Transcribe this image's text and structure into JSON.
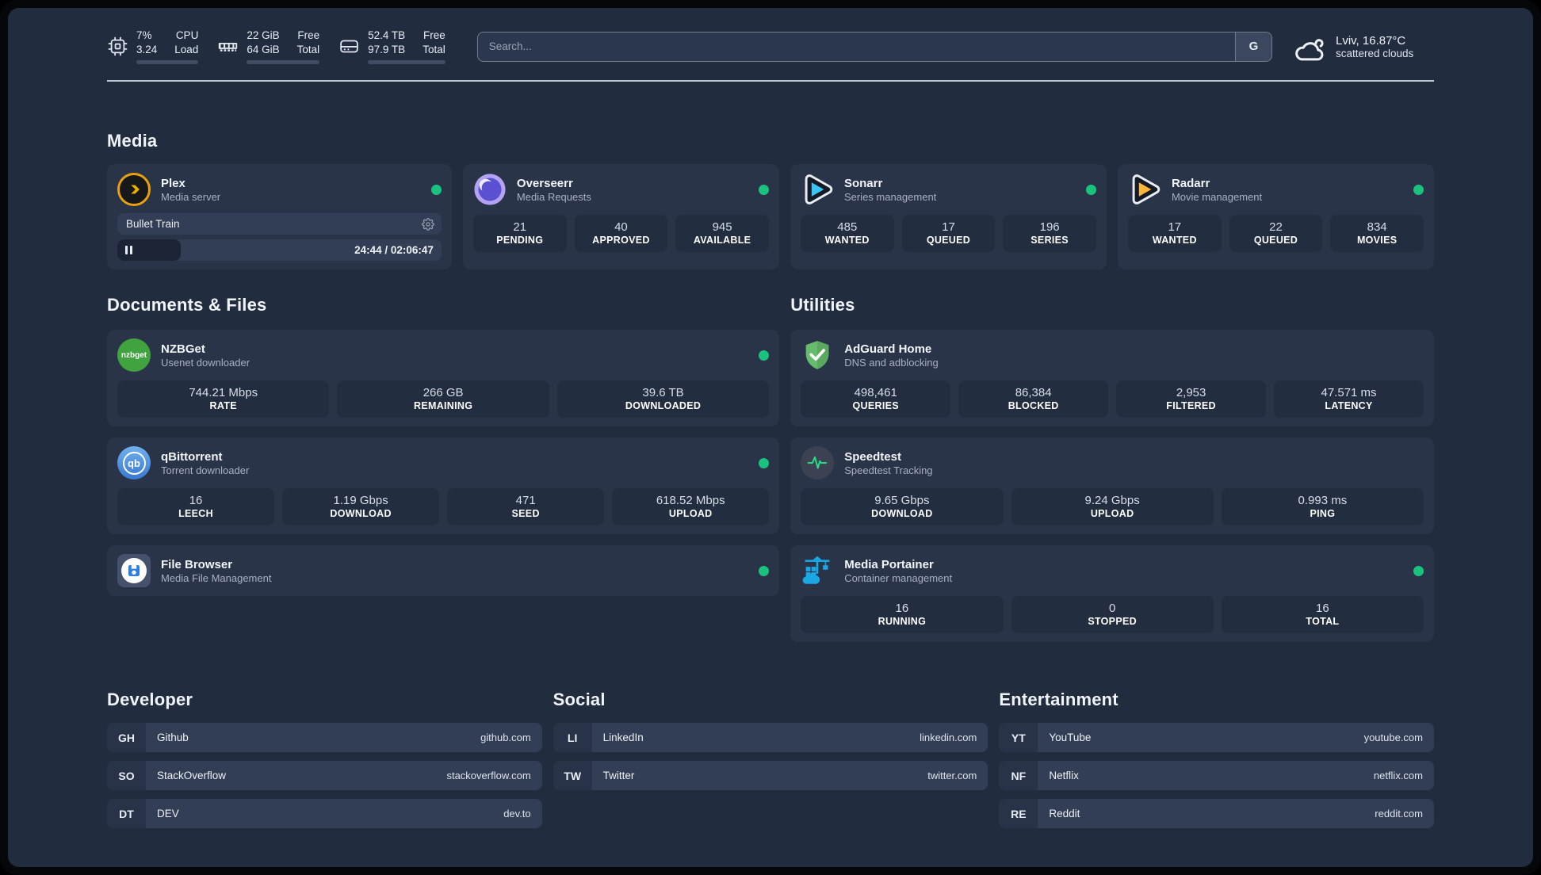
{
  "header": {
    "cpu": {
      "line1": "7%",
      "line2": "3.24",
      "label1": "CPU",
      "label2": "Load",
      "bar_percent": 7
    },
    "ram": {
      "line1": "22 GiB",
      "line2": "64 GiB",
      "label1": "Free",
      "label2": "Total",
      "bar_percent": 66
    },
    "disk": {
      "line1": "52.4 TB",
      "line2": "97.9 TB",
      "label1": "Free",
      "label2": "Total",
      "bar_percent": 46
    },
    "search": {
      "placeholder": "Search...",
      "engine_button": "G"
    },
    "weather": {
      "location_temp": "Lviv, 16.87°C",
      "condition": "scattered clouds"
    }
  },
  "sections": {
    "media": {
      "title": "Media",
      "apps": [
        {
          "name": "Plex",
          "subtitle": "Media server",
          "icon": "plex",
          "status_dot": true,
          "player": {
            "track": "Bullet Train",
            "time": "24:44 / 02:06:47",
            "progress_percent": 19.5
          }
        },
        {
          "name": "Overseerr",
          "subtitle": "Media Requests",
          "icon": "overseerr",
          "status_dot": true,
          "stats": [
            {
              "value": "21",
              "label": "PENDING"
            },
            {
              "value": "40",
              "label": "APPROVED"
            },
            {
              "value": "945",
              "label": "AVAILABLE"
            }
          ]
        },
        {
          "name": "Sonarr",
          "subtitle": "Series management",
          "icon": "sonarr",
          "status_dot": true,
          "stats": [
            {
              "value": "485",
              "label": "WANTED"
            },
            {
              "value": "17",
              "label": "QUEUED"
            },
            {
              "value": "196",
              "label": "SERIES"
            }
          ]
        },
        {
          "name": "Radarr",
          "subtitle": "Movie management",
          "icon": "radarr",
          "status_dot": true,
          "stats": [
            {
              "value": "17",
              "label": "WANTED"
            },
            {
              "value": "22",
              "label": "QUEUED"
            },
            {
              "value": "834",
              "label": "MOVIES"
            }
          ]
        }
      ]
    },
    "documents": {
      "title": "Documents & Files",
      "apps": [
        {
          "name": "NZBGet",
          "subtitle": "Usenet downloader",
          "icon": "nzbget",
          "status_dot": true,
          "stats": [
            {
              "value": "744.21 Mbps",
              "label": "RATE"
            },
            {
              "value": "266 GB",
              "label": "REMAINING"
            },
            {
              "value": "39.6 TB",
              "label": "DOWNLOADED"
            }
          ]
        },
        {
          "name": "qBittorrent",
          "subtitle": "Torrent downloader",
          "icon": "qbittorrent",
          "status_dot": true,
          "stats": [
            {
              "value": "16",
              "label": "LEECH"
            },
            {
              "value": "1.19 Gbps",
              "label": "DOWNLOAD"
            },
            {
              "value": "471",
              "label": "SEED"
            },
            {
              "value": "618.52 Mbps",
              "label": "UPLOAD"
            }
          ]
        },
        {
          "name": "File Browser",
          "subtitle": "Media File Management",
          "icon": "filebrowser",
          "status_dot": true,
          "stats": []
        }
      ]
    },
    "utilities": {
      "title": "Utilities",
      "apps": [
        {
          "name": "AdGuard Home",
          "subtitle": "DNS and adblocking",
          "icon": "adguard",
          "status_dot": false,
          "stats": [
            {
              "value": "498,461",
              "label": "QUERIES"
            },
            {
              "value": "86,384",
              "label": "BLOCKED"
            },
            {
              "value": "2,953",
              "label": "FILTERED"
            },
            {
              "value": "47.571 ms",
              "label": "LATENCY"
            }
          ]
        },
        {
          "name": "Speedtest",
          "subtitle": "Speedtest Tracking",
          "icon": "speedtest",
          "status_dot": false,
          "stats": [
            {
              "value": "9.65 Gbps",
              "label": "DOWNLOAD"
            },
            {
              "value": "9.24 Gbps",
              "label": "UPLOAD"
            },
            {
              "value": "0.993 ms",
              "label": "PING"
            }
          ]
        },
        {
          "name": "Media Portainer",
          "subtitle": "Container management",
          "icon": "portainer",
          "status_dot": true,
          "stats": [
            {
              "value": "16",
              "label": "RUNNING"
            },
            {
              "value": "0",
              "label": "STOPPED"
            },
            {
              "value": "16",
              "label": "TOTAL"
            }
          ]
        }
      ]
    },
    "links": [
      {
        "title": "Developer",
        "items": [
          {
            "abbr": "GH",
            "name": "Github",
            "url": "github.com"
          },
          {
            "abbr": "SO",
            "name": "StackOverflow",
            "url": "stackoverflow.com"
          },
          {
            "abbr": "DT",
            "name": "DEV",
            "url": "dev.to"
          }
        ]
      },
      {
        "title": "Social",
        "items": [
          {
            "abbr": "LI",
            "name": "LinkedIn",
            "url": "linkedin.com"
          },
          {
            "abbr": "TW",
            "name": "Twitter",
            "url": "twitter.com"
          }
        ]
      },
      {
        "title": "Entertainment",
        "items": [
          {
            "abbr": "YT",
            "name": "YouTube",
            "url": "youtube.com"
          },
          {
            "abbr": "NF",
            "name": "Netflix",
            "url": "netflix.com"
          },
          {
            "abbr": "RE",
            "name": "Reddit",
            "url": "reddit.com"
          }
        ]
      }
    ]
  },
  "colors": {
    "background": "#212c3f",
    "card": "#2a3449",
    "tile": "#222d40",
    "status_green": "#19c37d",
    "plex_gold": "#e8a00d",
    "sonarr_cyan": "#38c6f4",
    "radarr_yellow": "#ffb53c",
    "portainer_blue": "#1ba7e3",
    "adguard_green": "#66bb6c"
  }
}
